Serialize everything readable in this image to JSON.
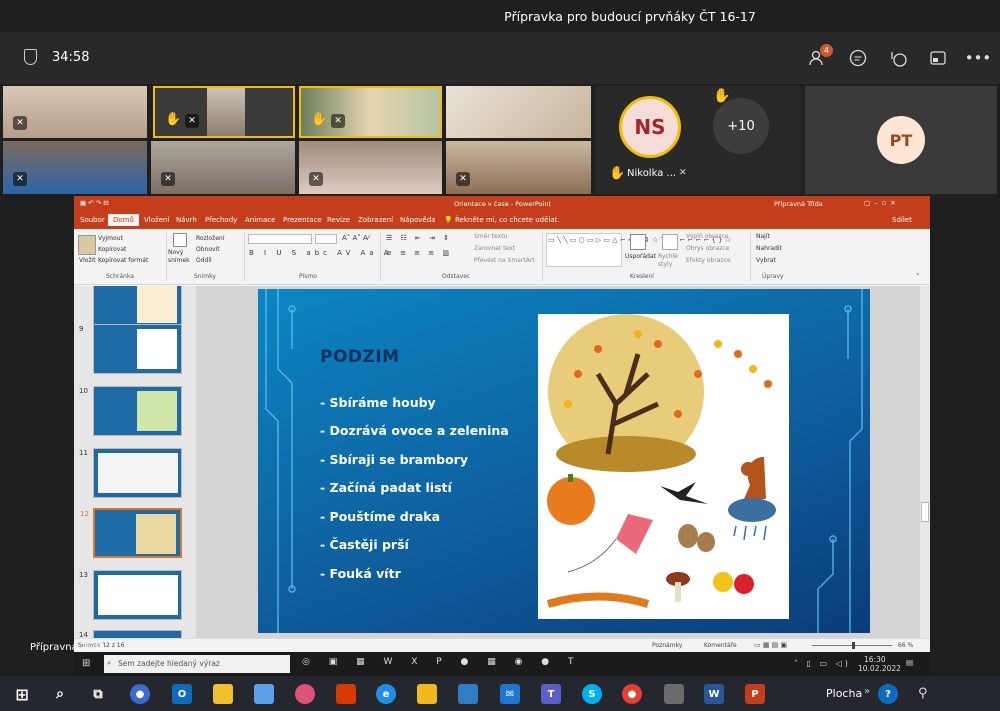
{
  "meeting": {
    "title": "Přípravka pro budoucí prvňáky ČT 16-17",
    "timer": "34:58",
    "participants_badge": "4"
  },
  "gallery": {
    "ns_initials": "NS",
    "ns_name": "Nikolka ...",
    "more_count": "+10",
    "pt_initials": "PT"
  },
  "ppt": {
    "window_title": "Orientace v čase  -  PowerPoint",
    "user": "Přípravná Třída",
    "tabs": [
      "Soubor",
      "Domů",
      "Vložení",
      "Návrh",
      "Přechody",
      "Animace",
      "Prezentace",
      "Revize",
      "Zobrazení",
      "Nápověda"
    ],
    "tell_me": "Řekněte mi, co chcete udělat.",
    "share": "Sdílet",
    "ribbon": {
      "paste": "Vložit",
      "cut": "Vyjmout",
      "copy": "Kopírovat",
      "format_painter": "Kopírovat formát",
      "clipboard": "Schránka",
      "new_slide": "Nový snímek",
      "layout": "Rozložení",
      "reset": "Obnovit",
      "section": "Oddíl",
      "slides": "Snímky",
      "font": "Písmo",
      "paragraph": "Odstavec",
      "text_dir": "Směr textu",
      "align_text": "Zarovnat text",
      "smartart": "Převést na SmartArt",
      "arrange": "Uspořádat",
      "quick_styles": "Rychlé styly",
      "drawing": "Kreslení",
      "shape_fill": "Výplň obrazce",
      "shape_outline": "Obrys obrazce",
      "shape_effects": "Efekty obrazce",
      "find": "Najít",
      "replace": "Nahradit",
      "select": "Vybrat",
      "editing": "Úpravy"
    },
    "thumbs": [
      "9",
      "10",
      "11",
      "12",
      "13",
      "14"
    ],
    "status_left": "Snímek 12 z 16",
    "status_notes": "Poznámky",
    "status_comments": "Komentáře",
    "zoom": "66 %"
  },
  "slide": {
    "title": "PODZIM",
    "bullets": [
      "- Sbíráme houby",
      "- Dozrává ovoce a zelenina",
      "- Sbíraji se brambory",
      "- Začíná padat listí",
      "- Pouštíme draka",
      "- Častěji prší",
      "- Fouká vítr"
    ]
  },
  "share_name": "Přípravná Třída",
  "inner_taskbar": {
    "search": "Sem zadejte hledaný výraz",
    "time": "16:30",
    "date": "10.02.2022"
  },
  "taskbar": {
    "desktop": "Plocha"
  },
  "colors": {
    "ppt_red": "#c43e1c",
    "teams_bg": "#1f1f1f",
    "highlight": "#f0c000"
  }
}
